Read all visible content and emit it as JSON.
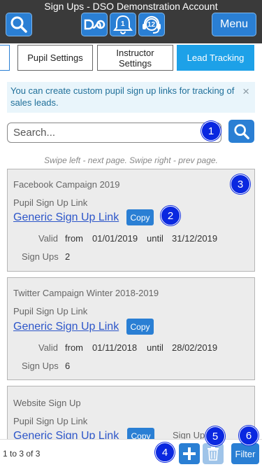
{
  "header": {
    "title": "Sign Ups - DSO Demonstration Account",
    "search_icon": "search-icon",
    "logo_icon": "dso-logo-icon",
    "notifications_icon": "bell-icon",
    "notifications_count": "1",
    "support_icon": "headset-icon",
    "support_count": "12",
    "menu_label": "Menu",
    "accent": "#2a7fd4",
    "bar_color": "#3a3a3a"
  },
  "tabs": [
    {
      "label": ""
    },
    {
      "label": "Pupil Settings"
    },
    {
      "label": "Instructor Settings"
    },
    {
      "label": "Lead Tracking",
      "active": true
    }
  ],
  "alert": {
    "text": "You can create custom pupil sign up links for tracking of sales leads.",
    "close": "×"
  },
  "search": {
    "placeholder": "Search...",
    "button_icon": "search-icon"
  },
  "hint": "Swipe left - next page. Swipe right - prev page.",
  "callouts": [
    "1",
    "2",
    "3",
    "4",
    "5",
    "6"
  ],
  "cards": [
    {
      "campaign": "Facebook Campaign 2019",
      "sub": "Pupil Sign Up Link",
      "link": "Generic Sign Up Link",
      "copy": "Copy",
      "valid_label": "Valid",
      "from_label": "from",
      "from": "01/01/2019",
      "until_label": "until",
      "until": "31/12/2019",
      "signups_label": "Sign Ups",
      "signups": "2"
    },
    {
      "campaign": "Twitter Campaign Winter 2018-2019",
      "sub": "Pupil Sign Up Link",
      "link": "Generic Sign Up Link",
      "copy": "Copy",
      "valid_label": "Valid",
      "from_label": "from",
      "from": "01/11/2018",
      "until_label": "until",
      "until": "28/02/2019",
      "signups_label": "Sign Ups",
      "signups": "6"
    },
    {
      "campaign": "Website Sign Up",
      "sub": "Pupil Sign Up Link",
      "link": "Generic Sign Up Link",
      "copy": "Copy",
      "signups_label": "Sign Ups"
    }
  ],
  "footer": {
    "count": "1 to 3 of 3",
    "add_icon": "plus-icon",
    "delete_icon": "trash-icon",
    "filter_label": "Filter"
  }
}
